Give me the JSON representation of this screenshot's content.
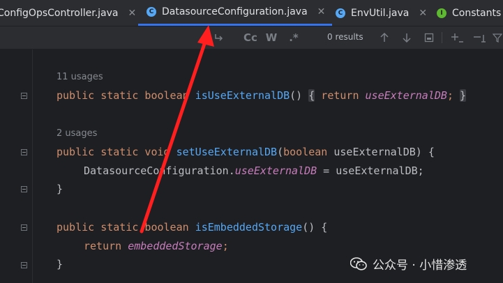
{
  "tabs": [
    {
      "label": "ConfigOpsController.java",
      "icon": "none",
      "active": false
    },
    {
      "label": "DatasourceConfiguration.java",
      "icon": "class-icon",
      "icon_letter": "C",
      "active": true
    },
    {
      "label": "EnvUtil.java",
      "icon": "class-icon",
      "icon_letter": "C",
      "active": false
    },
    {
      "label": "Constants",
      "icon": "interface-icon",
      "icon_letter": "I",
      "active": false
    }
  ],
  "close_glyph": "✕",
  "findbar": {
    "match_case": "Cc",
    "words": "W",
    "regex": ".*",
    "results": "0 results"
  },
  "code": {
    "usages_1": "11 usages",
    "usages_2": "2 usages",
    "l1_kw": "public static boolean ",
    "l1_fn": "isUseExternalDB",
    "l1_paren": "()",
    "l1_open": "{",
    "l1_return": " return ",
    "l1_field": "useExternalDB",
    "l1_semi": ";",
    "l1_close": "}",
    "l2_kw": "public static void ",
    "l2_fn": "setUseExternalDB",
    "l2_open": "(",
    "l2_type": "boolean",
    "l2_param": " useExternalDB) {",
    "l3_class": "DatasourceConfiguration.",
    "l3_field": "useExternalDB",
    "l3_rest": " = useExternalDB;",
    "l4": "}",
    "l5_kw": "public static boolean ",
    "l5_fn": "isEmbeddedStorage",
    "l5_rest": "() {",
    "l6_kw": "return ",
    "l6_field": "embeddedStorage",
    "l6_semi": ";",
    "l7": "}"
  },
  "watermark": {
    "text": "公众号 · 小惜渗透"
  },
  "colors": {
    "accent_tab": "#3574f0",
    "arrow": "#ff1f1f",
    "keyword": "#cf8e6d",
    "function": "#56a8f5",
    "field": "#c77dbb"
  }
}
